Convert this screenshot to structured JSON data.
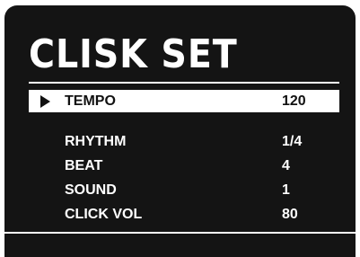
{
  "screen": {
    "title": "CLISK SET",
    "menu": {
      "items": [
        {
          "label": "TEMPO",
          "value": "120",
          "selected": true
        },
        {
          "label": "RHYTHM",
          "value": "1/4",
          "selected": false
        },
        {
          "label": "BEAT",
          "value": "4",
          "selected": false
        },
        {
          "label": "SOUND",
          "value": "1",
          "selected": false
        },
        {
          "label": "CLICK VOL",
          "value": "80",
          "selected": false
        }
      ],
      "selection_icon": "play-arrow-icon"
    }
  },
  "colors": {
    "background": "#141414",
    "text": "#ffffff",
    "highlight": "#ffffff",
    "highlight_text": "#111111"
  }
}
